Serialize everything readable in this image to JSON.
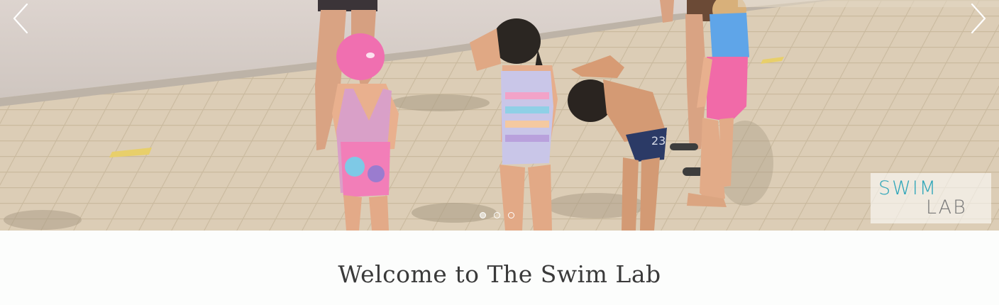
{
  "slider": {
    "prev_icon": "chevron-left-icon",
    "next_icon": "chevron-right-icon",
    "slide_count": 3,
    "active_slide": 1
  },
  "logo": {
    "line1": "SWIM",
    "line2": "LAB"
  },
  "welcome": {
    "title": "Welcome to The Swim Lab"
  }
}
